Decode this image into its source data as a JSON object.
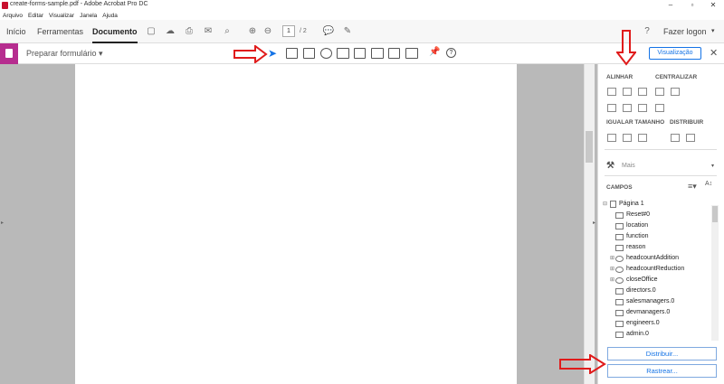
{
  "window": {
    "title": "create-forms-sample.pdf - Adobe Acrobat Pro DC"
  },
  "menu": [
    "Arquivo",
    "Editar",
    "Visualizar",
    "Janela",
    "Ajuda"
  ],
  "tabs": {
    "home": "Início",
    "tools": "Ferramentas",
    "document": "Documento"
  },
  "pagination": {
    "current": "1",
    "total": "/ 2"
  },
  "account": {
    "login": "Fazer logon",
    "help": "?"
  },
  "formbar": {
    "title": "Preparar formulário",
    "preview": "Visualização"
  },
  "panel": {
    "align": "ALINHAR",
    "center": "CENTRALIZAR",
    "match_size": "IGUALAR TAMANHO",
    "distribute": "DISTRIBUIR",
    "more": "Mais",
    "fields": "CAMPOS",
    "page_node": "Página 1",
    "fields_list": [
      "Reset#0",
      "location",
      "function",
      "reason",
      "headcountAddition",
      "headcountReduction",
      "closeOffice",
      "directors.0",
      "salesmanagers.0",
      "devmanagers.0",
      "engineers.0",
      "admin.0"
    ],
    "distribute_btn": "Distribuir...",
    "track_btn": "Rastrear..."
  },
  "colors": {
    "accent": "#1473e6",
    "form_tool": "#b62d8f",
    "annotation": "#e01b1b"
  }
}
